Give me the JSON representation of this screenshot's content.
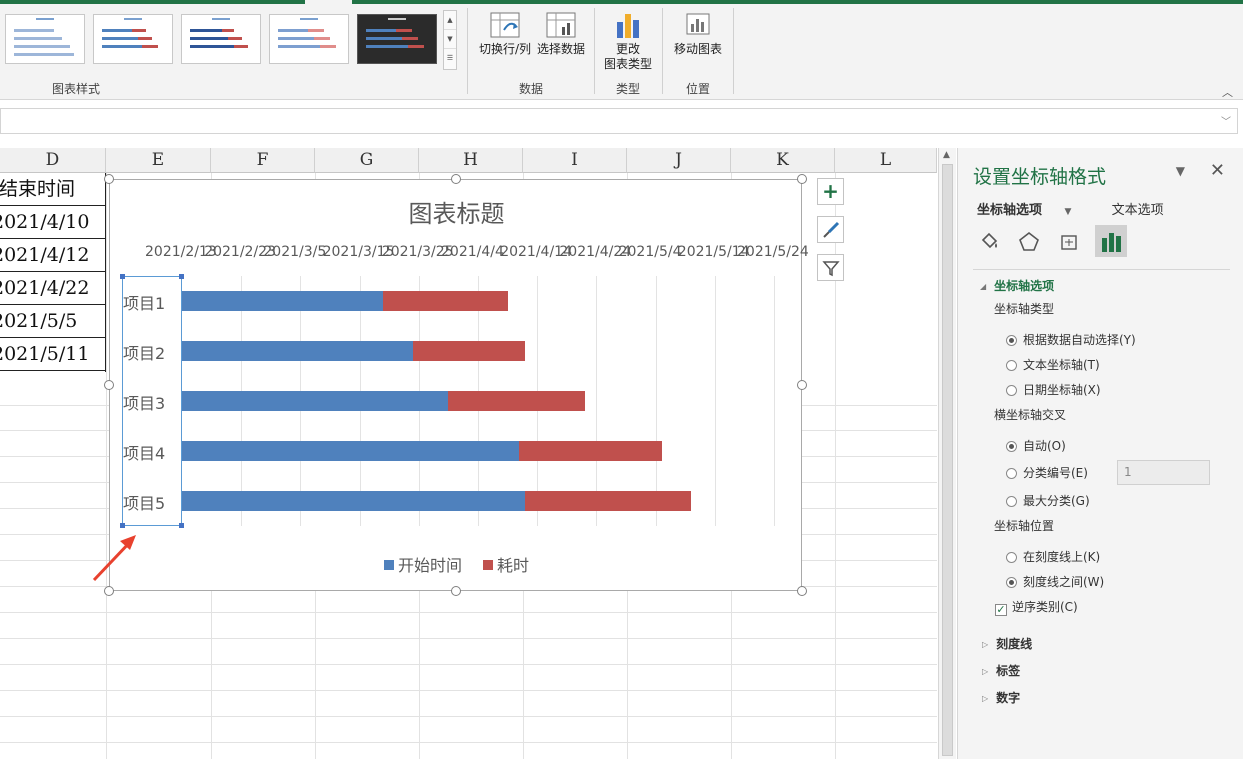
{
  "ribbon": {
    "groups": {
      "chart_styles": "图表样式",
      "data": "数据",
      "type": "类型",
      "location": "位置"
    },
    "buttons": {
      "switch_row_col": "切换行/列",
      "select_data": "选择数据",
      "change_chart_type_line1": "更改",
      "change_chart_type_line2": "图表类型",
      "move_chart": "移动图表"
    }
  },
  "sheet": {
    "columns": [
      "D",
      "E",
      "F",
      "G",
      "H",
      "I",
      "J",
      "K",
      "L"
    ],
    "column_d_cells": [
      "计结束时间",
      "2021/4/10",
      "2021/4/12",
      "2021/4/22",
      "2021/5/5",
      "2021/5/11"
    ]
  },
  "chart": {
    "title": "图表标题",
    "x_tick_labels": [
      "2021/2/13",
      "2021/2/23",
      "2021/3/5",
      "2021/3/15",
      "2021/3/25",
      "2021/4/4",
      "2021/4/14",
      "2021/4/24",
      "2021/5/4",
      "2021/5/14",
      "2021/5/24"
    ],
    "legend": [
      "开始时间",
      "耗时"
    ],
    "colors": {
      "start": "#4f81bd",
      "duration": "#c0504d"
    }
  },
  "chart_data": {
    "type": "bar",
    "orientation": "horizontal-stacked",
    "title": "图表标题",
    "categories": [
      "项目1",
      "项目2",
      "项目3",
      "项目4",
      "项目5"
    ],
    "series": [
      {
        "name": "开始时间",
        "values": [
          "2021/3/19",
          "2021/3/24",
          "2021/3/30",
          "2021/4/11",
          "2021/4/12"
        ]
      },
      {
        "name": "耗时",
        "values": [
          21,
          19,
          23,
          24,
          28
        ]
      }
    ],
    "end_dates": [
      "2021/4/10",
      "2021/4/12",
      "2021/4/22",
      "2021/5/5",
      "2021/5/11"
    ],
    "xlim": [
      "2021/2/13",
      "2021/5/24"
    ],
    "x_tick_step_days": 10,
    "grid": true,
    "legend_position": "bottom",
    "reverse_categories": true
  },
  "pane": {
    "title": "设置坐标轴格式",
    "tab_axis_options": "坐标轴选项",
    "tab_text_options": "文本选项",
    "section_axis_options": "坐标轴选项",
    "axis_type_label": "坐标轴类型",
    "axis_type_options": [
      "根据数据自动选择(Y)",
      "文本坐标轴(T)",
      "日期坐标轴(X)"
    ],
    "crosses_label": "横坐标轴交叉",
    "crosses_options": [
      "自动(O)",
      "分类编号(E)",
      "最大分类(G)"
    ],
    "crosses_value": "1",
    "axis_position_label": "坐标轴位置",
    "axis_position_options": [
      "在刻度线上(K)",
      "刻度线之间(W)"
    ],
    "reverse_order": "逆序类别(C)",
    "collapsed_sections": [
      "刻度线",
      "标签",
      "数字"
    ]
  }
}
